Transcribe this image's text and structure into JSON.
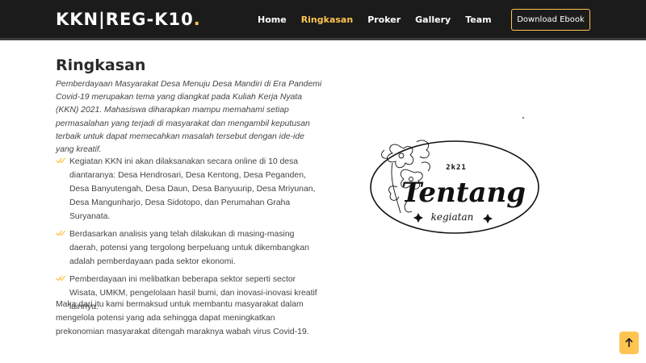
{
  "header": {
    "logo_text": "KKN|REG-K10",
    "logo_dot": ".",
    "nav": [
      {
        "label": "Home"
      },
      {
        "label": "Ringkasan"
      },
      {
        "label": "Proker"
      },
      {
        "label": "Gallery"
      },
      {
        "label": "Team"
      }
    ],
    "cta_label": "Download Ebook"
  },
  "main": {
    "title": "Ringkasan",
    "intro": "Pemberdayaan Masyarakat Desa Menuju Desa Mandiri di Era Pandemi Covid-19 merupakan tema yang diangkat pada Kuliah Kerja Nyata (KKN) 2021. Mahasiswa diharapkan mampu memahami setiap permasalahan yang terjadi di masyarakat dan mengambil keputusan terbaik untuk dapat memecahkan masalah tersebut dengan ide-ide yang kreatif.",
    "bullets": [
      "Kegiatan KKN ini akan dilaksanakan secara online di 10 desa diantaranya: Desa Hendrosari, Desa Kentong, Desa Peganden, Desa Banyutengah, Desa Daun, Desa Banyuurip, Desa Mriyunan, Desa Mangunharjo, Desa Sidotopo, dan Perumahan Graha Suryanata.",
      "Berdasarkan analisis yang telah dilakukan di masing-masing daerah, potensi yang tergolong berpeluang untuk dikembangkan adalah pemberdayaan pada sektor ekonomi.",
      "Pemberdayaan ini melibatkan beberapa sektor seperti sector Wisata, UMKM, pengelolaan hasil bumi, dan inovasi-inovasi kreatif lainnya."
    ],
    "outro": "Maka dari itu kami bermaksud untuk membantu masyarakat dalam mengelola potensi yang ada sehingga dapat meningkatkan prekonomian masyarakat ditengah maraknya wabah virus Covid-19."
  },
  "illustration": {
    "year": "2k21",
    "word_main": "Tentang",
    "word_sub": "kegiatan"
  },
  "colors": {
    "accent": "#ffc451",
    "header_bg": "#1b1b1b"
  },
  "icons": {
    "bullet": "check-double-icon",
    "back_to_top": "arrow-up-icon"
  }
}
